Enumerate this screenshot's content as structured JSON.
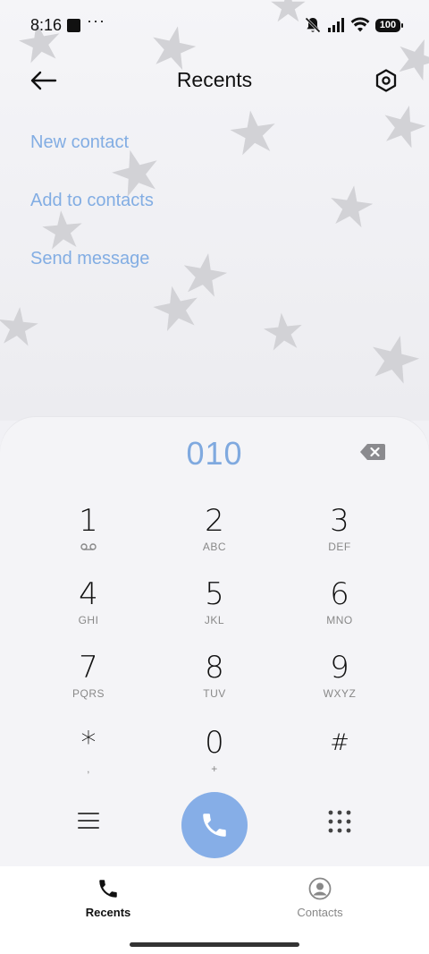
{
  "status_bar": {
    "time": "8:16",
    "battery": "100"
  },
  "header": {
    "title": "Recents"
  },
  "actions": {
    "new_contact": "New contact",
    "add_to_contacts": "Add to contacts",
    "send_message": "Send message"
  },
  "dialer": {
    "number": "010",
    "keys": [
      {
        "digit": "1",
        "letters": ""
      },
      {
        "digit": "2",
        "letters": "ABC"
      },
      {
        "digit": "3",
        "letters": "DEF"
      },
      {
        "digit": "4",
        "letters": "GHI"
      },
      {
        "digit": "5",
        "letters": "JKL"
      },
      {
        "digit": "6",
        "letters": "MNO"
      },
      {
        "digit": "7",
        "letters": "PQRS"
      },
      {
        "digit": "8",
        "letters": "TUV"
      },
      {
        "digit": "9",
        "letters": "WXYZ"
      },
      {
        "digit": "*",
        "letters": ","
      },
      {
        "digit": "0",
        "letters": "+"
      },
      {
        "digit": "#",
        "letters": ""
      }
    ]
  },
  "nav": {
    "recents": "Recents",
    "contacts": "Contacts"
  },
  "colors": {
    "accent": "#82ade3",
    "call_button": "#86aee7"
  },
  "icons": {
    "back": "arrow-left-icon",
    "settings": "hexagon-settings-icon",
    "backspace": "backspace-icon",
    "voicemail": "voicemail-icon",
    "menu": "menu-icon",
    "call": "phone-icon",
    "dialpad": "dialpad-icon",
    "recents_tab": "phone-icon",
    "contacts_tab": "person-circle-icon"
  }
}
